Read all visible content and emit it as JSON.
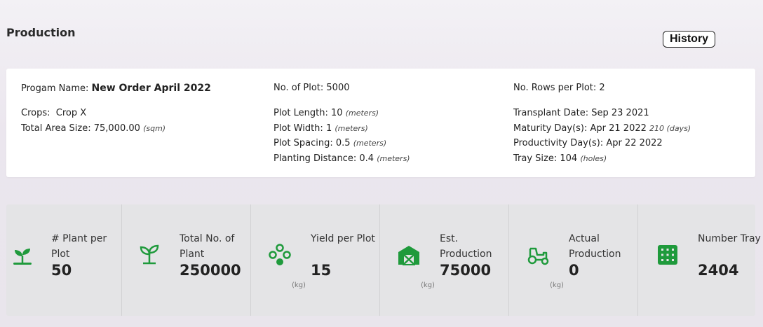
{
  "header": {
    "title": "Production",
    "history_label": "History"
  },
  "info": {
    "program_label": "Progam Name:",
    "program_value": "New Order April 2022",
    "crops_label": "Crops:",
    "crops_value": "Crop X",
    "total_area_label": "Total Area Size:",
    "total_area_value": "75,000.00",
    "total_area_unit": "(sqm)",
    "no_plot_label": "No. of Plot:",
    "no_plot_value": "5000",
    "plot_length_label": "Plot Length:",
    "plot_length_value": "10",
    "plot_length_unit": "(meters)",
    "plot_width_label": "Plot Width:",
    "plot_width_value": "1",
    "plot_width_unit": "(meters)",
    "plot_spacing_label": "Plot Spacing:",
    "plot_spacing_value": "0.5",
    "plot_spacing_unit": "(meters)",
    "planting_distance_label": "Planting Distance:",
    "planting_distance_value": "0.4",
    "planting_distance_unit": "(meters)",
    "rows_per_plot_label": "No. Rows per Plot:",
    "rows_per_plot_value": "2",
    "transplant_date_label": "Transplant Date:",
    "transplant_date_value": "Sep 23 2021",
    "maturity_label": "Maturity Day(s):",
    "maturity_value": "Apr 21 2022",
    "maturity_unit": "210 (days)",
    "productivity_label": "Productivity Day(s):",
    "productivity_value": "Apr 22 2022",
    "tray_size_label": "Tray Size:",
    "tray_size_value": "104",
    "tray_size_unit": "(holes)"
  },
  "stats": [
    {
      "label": "# Plant per Plot",
      "value": "50",
      "unit": "",
      "icon": "sprout-icon"
    },
    {
      "label": "Total No. of Plant",
      "value": "250000",
      "unit": "",
      "icon": "seedling-icon"
    },
    {
      "label": "Yield per Plot",
      "value": "15",
      "unit": "(kg)",
      "icon": "seeds-icon"
    },
    {
      "label": "Est. Production",
      "value": "75000",
      "unit": "(kg)",
      "icon": "barn-icon"
    },
    {
      "label": "Actual Production",
      "value": "0",
      "unit": "(kg)",
      "icon": "tractor-icon"
    },
    {
      "label": "Number Tray",
      "value": "2404",
      "unit": "",
      "icon": "tray-grid-icon"
    }
  ],
  "colors": {
    "accent_green": "#1f9a3c",
    "card_bg": "#ffffff",
    "stats_bg": "#e4e4e6"
  }
}
